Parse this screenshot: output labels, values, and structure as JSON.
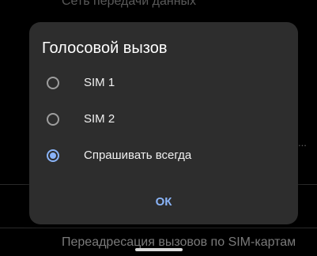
{
  "background": {
    "top_text": "Сеть передачи данных",
    "bottom_text": "Переадресация вызовов по SIM-картам",
    "ellipsis": "..."
  },
  "dialog": {
    "title": "Голосовой вызов",
    "options": [
      {
        "label": "SIM 1",
        "selected": false
      },
      {
        "label": "SIM 2",
        "selected": false
      },
      {
        "label": "Спрашивать всегда",
        "selected": true
      }
    ],
    "ok_label": "ОК"
  },
  "colors": {
    "accent": "#8ab4f8",
    "dialog_bg": "#2d2d2d",
    "page_bg": "#000000"
  }
}
